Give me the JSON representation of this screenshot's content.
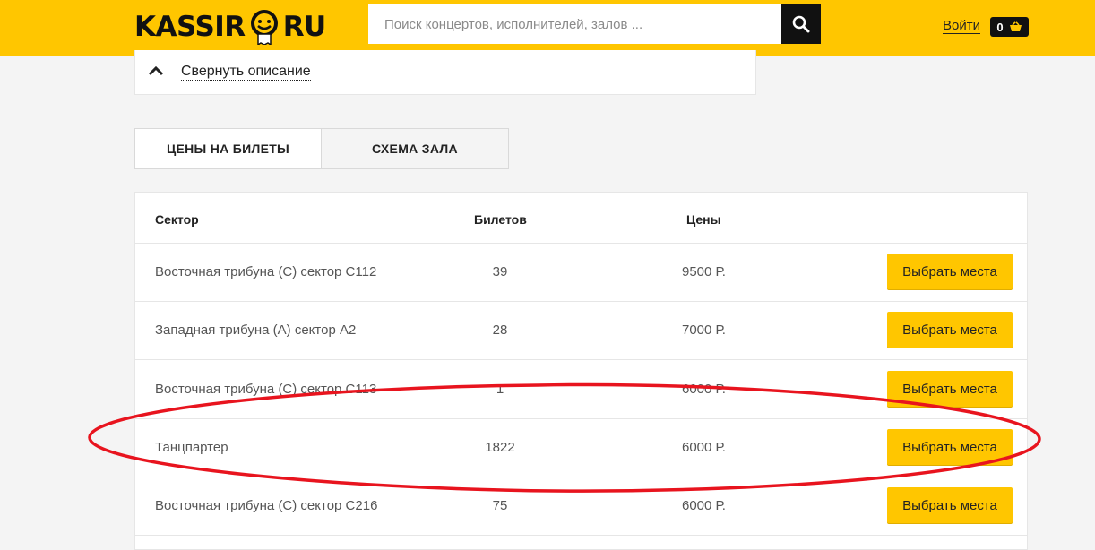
{
  "header": {
    "logo_left": "KASSIR",
    "logo_right": "RU",
    "search_placeholder": "Поиск концертов, исполнителей, залов ...",
    "search_icon": "search-icon",
    "login_label": "Войти",
    "cart_count": "0",
    "cart_icon": "basket-icon",
    "brand_color": "#ffc600"
  },
  "description": {
    "toggle_label": "Свернуть описание",
    "toggle_icon": "chevron-up-icon"
  },
  "tabs": [
    {
      "label": "ЦЕНЫ НА БИЛЕТЫ",
      "active": true
    },
    {
      "label": "СХЕМА ЗАЛА",
      "active": false
    }
  ],
  "table": {
    "headers": {
      "sector": "Сектор",
      "count": "Билетов",
      "price": "Цены"
    },
    "rows": [
      {
        "sector": "Восточная трибуна (С) сектор С112",
        "count": "39",
        "price": "9500 Р.",
        "button": "Выбрать места"
      },
      {
        "sector": "Западная трибуна (А) сектор А2",
        "count": "28",
        "price": "7000 Р.",
        "button": "Выбрать места"
      },
      {
        "sector": "Восточная трибуна (С) сектор С113",
        "count": "1",
        "price": "6000 Р.",
        "button": "Выбрать места"
      },
      {
        "sector": "Танцпартер",
        "count": "1822",
        "price": "6000 Р.",
        "button": "Выбрать места"
      },
      {
        "sector": "Восточная трибуна (С) сектор С216",
        "count": "75",
        "price": "6000 Р.",
        "button": "Выбрать места"
      }
    ]
  },
  "annotation": {
    "color": "#e8141e",
    "highlighted_row": "Танцпартер"
  }
}
